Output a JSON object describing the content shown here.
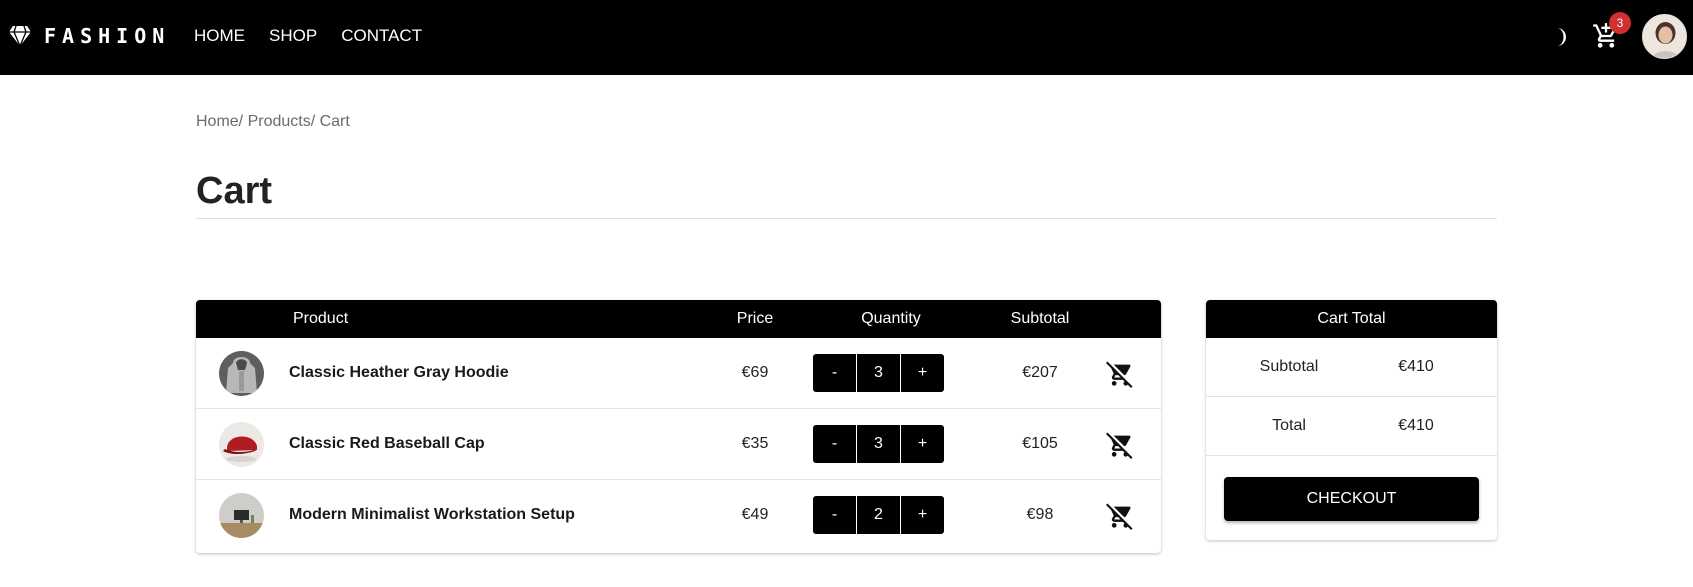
{
  "nav": {
    "brand": "FASHION",
    "links": [
      "HOME",
      "SHOP",
      "CONTACT"
    ],
    "cart_count": "3",
    "icons": {
      "brand": "diamond-icon",
      "theme": "moon-icon",
      "cart": "add-shopping-cart-icon",
      "avatar": "user-avatar"
    }
  },
  "breadcrumb": "Home/ Products/ Cart",
  "page_title": "Cart",
  "table": {
    "headers": {
      "product": "Product",
      "price": "Price",
      "quantity": "Quantity",
      "subtotal": "Subtotal"
    },
    "rows": [
      {
        "name": "Classic Heather Gray Hoodie",
        "price": "€69",
        "qty": "3",
        "subtotal": "€207",
        "image": "gray-hoodie"
      },
      {
        "name": "Classic Red Baseball Cap",
        "price": "€35",
        "qty": "3",
        "subtotal": "€105",
        "image": "red-cap"
      },
      {
        "name": "Modern Minimalist Workstation Setup",
        "price": "€49",
        "qty": "2",
        "subtotal": "€98",
        "image": "workstation"
      }
    ],
    "minus": "-",
    "plus": "+",
    "remove_icon": "remove-shopping-cart-icon"
  },
  "totals": {
    "title": "Cart Total",
    "subtotal_label": "Subtotal",
    "subtotal_value": "€410",
    "total_label": "Total",
    "total_value": "€410",
    "checkout": "CHECKOUT"
  }
}
